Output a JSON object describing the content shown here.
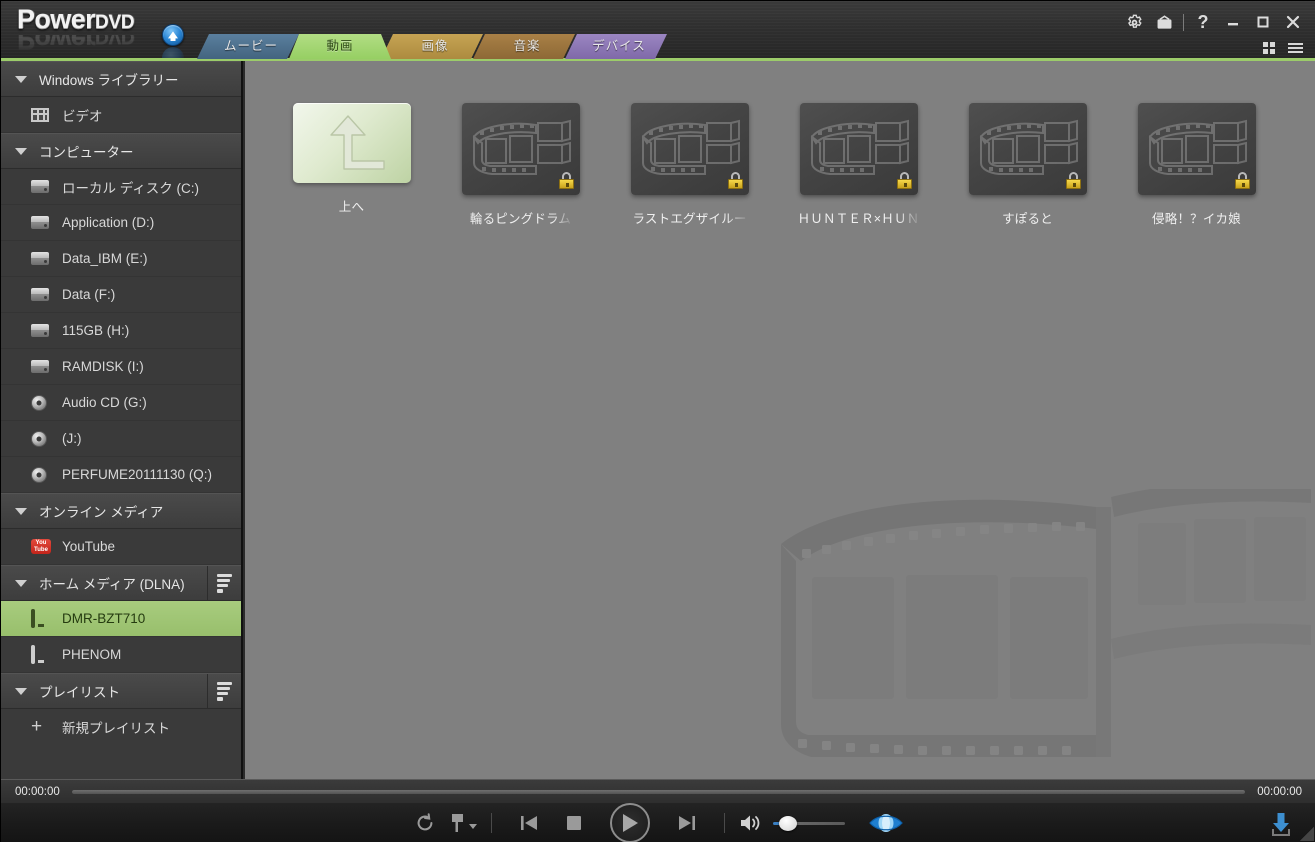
{
  "app": {
    "brand_main": "Power",
    "brand_sub": "DVD",
    "accent_green": "#9ccc6a",
    "content_bg": "#808080"
  },
  "titlebar": {
    "update_icon": "up-arrow-circle-icon",
    "buttons": [
      {
        "name": "settings-button",
        "icon": "gear-icon",
        "glyph": "⚙"
      },
      {
        "name": "tv-mode-button",
        "icon": "tv-icon",
        "glyph": "tv"
      },
      {
        "name": "help-button",
        "icon": "question-mark-icon",
        "glyph": "?"
      },
      {
        "name": "minimize-button",
        "icon": "minimize-icon",
        "glyph": "–"
      },
      {
        "name": "maximize-button",
        "icon": "maximize-icon",
        "glyph": "□"
      },
      {
        "name": "close-button",
        "icon": "close-icon",
        "glyph": "✕"
      }
    ],
    "sub_buttons": [
      {
        "name": "grid-view-button",
        "icon": "grid-view-icon"
      },
      {
        "name": "main-menu-button",
        "icon": "hamburger-menu-icon"
      }
    ]
  },
  "tabs": [
    {
      "label": "ムービー",
      "key": "movie",
      "active": false,
      "color": "#4f7491"
    },
    {
      "label": "動画",
      "key": "video",
      "active": true,
      "color": "#a4d474"
    },
    {
      "label": "画像",
      "key": "photo",
      "active": false,
      "color": "#b99749"
    },
    {
      "label": "音楽",
      "key": "music",
      "active": false,
      "color": "#9b753e"
    },
    {
      "label": "デバイス",
      "key": "device",
      "active": false,
      "color": "#8d77b5"
    }
  ],
  "sidebar": {
    "groups": [
      {
        "label": "Windows ライブラリー",
        "name": "windows-library",
        "menu": false,
        "items": [
          {
            "label": "ビデオ",
            "icon": "film-icon",
            "icon_kind": "film",
            "selected": false,
            "name": "sidebar-item-video"
          }
        ]
      },
      {
        "label": "コンピューター",
        "name": "computer",
        "menu": false,
        "items": [
          {
            "label": "ローカル ディスク (C:)",
            "icon": "hard-drive-icon",
            "icon_kind": "drive",
            "selected": false,
            "name": "sidebar-item-drive-c"
          },
          {
            "label": "Application (D:)",
            "icon": "hard-drive-icon",
            "icon_kind": "drive",
            "selected": false,
            "name": "sidebar-item-drive-d"
          },
          {
            "label": "Data_IBM (E:)",
            "icon": "hard-drive-icon",
            "icon_kind": "drive",
            "selected": false,
            "name": "sidebar-item-drive-e"
          },
          {
            "label": "Data (F:)",
            "icon": "hard-drive-icon",
            "icon_kind": "drive",
            "selected": false,
            "name": "sidebar-item-drive-f"
          },
          {
            "label": "115GB (H:)",
            "icon": "hard-drive-icon",
            "icon_kind": "drive",
            "selected": false,
            "name": "sidebar-item-drive-h"
          },
          {
            "label": "RAMDISK (I:)",
            "icon": "hard-drive-icon",
            "icon_kind": "drive",
            "selected": false,
            "name": "sidebar-item-drive-i"
          },
          {
            "label": "Audio CD (G:)",
            "icon": "disc-icon",
            "icon_kind": "disc",
            "selected": false,
            "name": "sidebar-item-drive-g"
          },
          {
            "label": "(J:)",
            "icon": "disc-icon",
            "icon_kind": "disc",
            "selected": false,
            "name": "sidebar-item-drive-j"
          },
          {
            "label": "PERFUME20111130 (Q:)",
            "icon": "disc-icon",
            "icon_kind": "disc",
            "selected": false,
            "name": "sidebar-item-drive-q"
          }
        ]
      },
      {
        "label": "オンライン メディア",
        "name": "online-media",
        "menu": false,
        "items": [
          {
            "label": "YouTube",
            "icon": "youtube-icon",
            "icon_kind": "youtube",
            "selected": false,
            "name": "sidebar-item-youtube"
          }
        ]
      },
      {
        "label": "ホーム メディア (DLNA)",
        "name": "home-media-dlna",
        "menu": true,
        "items": [
          {
            "label": "DMR-BZT710",
            "icon": "monitor-icon",
            "icon_kind": "monitor",
            "selected": true,
            "name": "sidebar-item-dmr-bzt710"
          },
          {
            "label": "PHENOM",
            "icon": "monitor-icon",
            "icon_kind": "monitor",
            "selected": false,
            "name": "sidebar-item-phenom"
          }
        ]
      },
      {
        "label": "プレイリスト",
        "name": "playlist",
        "menu": true,
        "items": [
          {
            "label": "新規プレイリスト",
            "icon": "plus-icon",
            "icon_kind": "plus",
            "selected": false,
            "name": "sidebar-item-new-playlist"
          }
        ]
      }
    ]
  },
  "content": {
    "items": [
      {
        "label": "上へ",
        "kind": "up",
        "locked": false,
        "truncated": false,
        "name": "thumb-up-level"
      },
      {
        "label": "輪るピングドラム",
        "kind": "video",
        "locked": true,
        "truncated": true,
        "name": "thumb-video-1"
      },
      {
        "label": "ラストエグザイルー",
        "kind": "video",
        "locked": true,
        "truncated": true,
        "name": "thumb-video-2"
      },
      {
        "label": "ＨＵＮＴＥＲ×ＨＵＮ",
        "kind": "video",
        "locked": true,
        "truncated": true,
        "name": "thumb-video-3"
      },
      {
        "label": "すぽると",
        "kind": "video",
        "locked": true,
        "truncated": false,
        "name": "thumb-video-4"
      },
      {
        "label": "侵略！？イカ娘",
        "kind": "video",
        "locked": true,
        "truncated": false,
        "name": "thumb-video-5"
      }
    ]
  },
  "seekbar": {
    "time_current": "00:00:00",
    "time_total": "00:00:00",
    "progress_percent": 0
  },
  "playbar": {
    "controls": [
      {
        "name": "repeat-button",
        "icon": "repeat-icon"
      },
      {
        "name": "bookmark-button",
        "icon": "bookmark-icon"
      },
      {
        "name": "previous-button",
        "icon": "previous-track-icon"
      },
      {
        "name": "stop-button",
        "icon": "stop-icon"
      },
      {
        "name": "play-button",
        "icon": "play-icon"
      },
      {
        "name": "next-button",
        "icon": "next-track-icon"
      },
      {
        "name": "mute-button",
        "icon": "volume-icon"
      },
      {
        "name": "volume-slider",
        "icon": "slider-icon"
      },
      {
        "name": "truetheater-button",
        "icon": "eye-icon"
      },
      {
        "name": "download-button",
        "icon": "download-arrow-icon"
      }
    ],
    "volume_percent": 10
  }
}
